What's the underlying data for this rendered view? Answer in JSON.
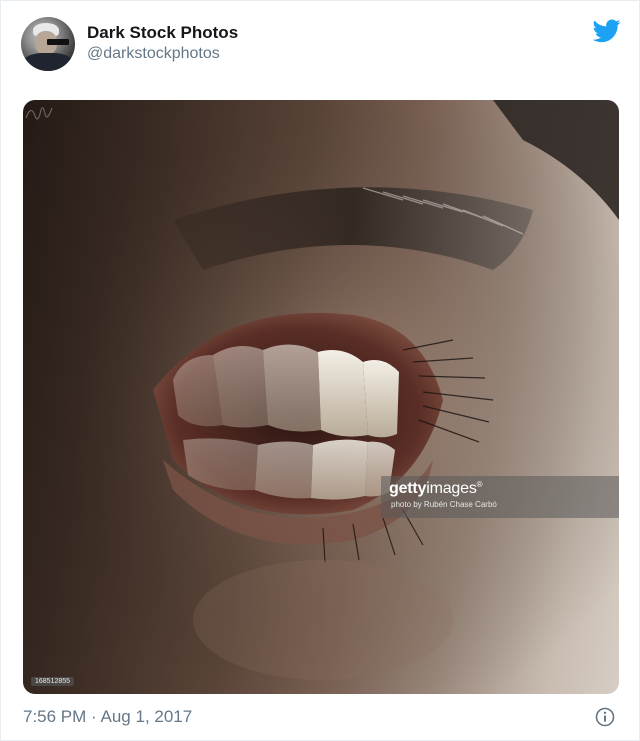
{
  "tweet": {
    "display_name": "Dark Stock Photos",
    "handle": "@darkstockphotos",
    "time": "7:56 PM",
    "separator": "·",
    "date": "Aug 1, 2017"
  },
  "icons": {
    "brand": "twitter-bird-icon",
    "info": "info-icon"
  },
  "colors": {
    "twitter_blue": "#1da1f2",
    "secondary_text": "#657786",
    "primary_text": "#14171a"
  },
  "photo": {
    "watermark_brand_bold": "getty",
    "watermark_brand_light": "images",
    "watermark_mark": "®",
    "credit": "photo by Rubén Chase Carbó",
    "stock_id": "168512855"
  }
}
